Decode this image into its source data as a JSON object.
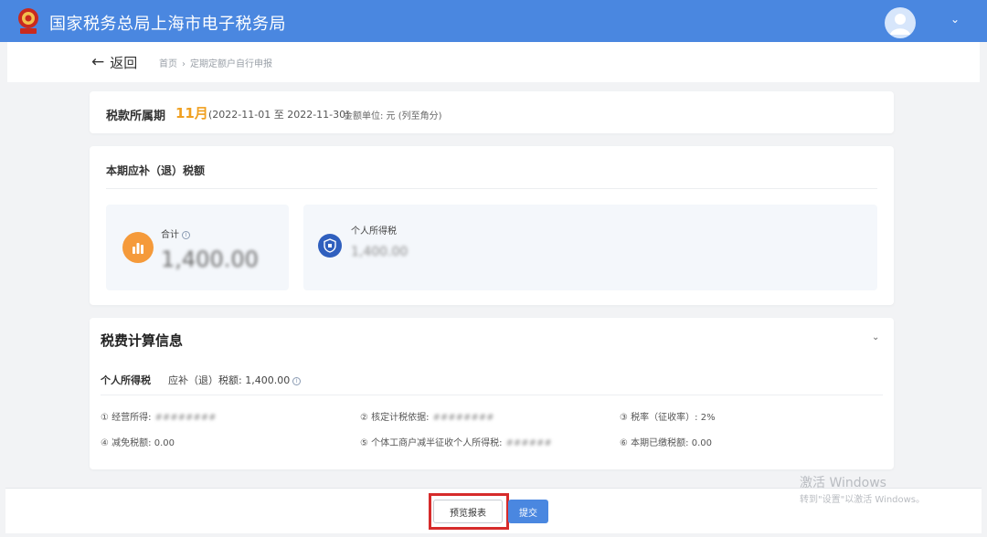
{
  "header": {
    "title": "国家税务总局上海市电子税务局"
  },
  "subnav": {
    "back_label": "返回",
    "breadcrumb": [
      "首页",
      "定期定额户自行申报"
    ]
  },
  "period": {
    "label": "税款所属期",
    "month": "11月",
    "range": "(2022-11-01 至 2022-11-30)",
    "unit": "金额单位: 元 (列至角分)"
  },
  "tax_amount": {
    "title": "本期应补（退）税额",
    "total_label": "合计",
    "total_value": "1,400.00",
    "personal_label": "个人所得税",
    "personal_value": "1,400.00"
  },
  "calc": {
    "title": "税费计算信息",
    "tax_name": "个人所得税",
    "tax_amount": "应补（退）税额: 1,400.00",
    "fields": {
      "f1_label": "① 经营所得:",
      "f2_label": "② 核定计税依据:",
      "f3_label": "③ 税率（征收率）:",
      "f3_value": "2%",
      "f4_label": "④ 减免税额:",
      "f4_value": "0.00",
      "f5_label": "⑤ 个体工商户减半征收个人所得税:",
      "f6_label": "⑥ 本期已缴税额:",
      "f6_value": "0.00"
    }
  },
  "actions": {
    "preview": "预览报表",
    "submit": "提交"
  },
  "watermark": {
    "line1": "激活 Windows",
    "line2": "转到\"设置\"以激活 Windows。"
  },
  "colors": {
    "primary": "#4a87e0",
    "accent_orange": "#f0a020",
    "highlight_red": "#d62b2b"
  }
}
